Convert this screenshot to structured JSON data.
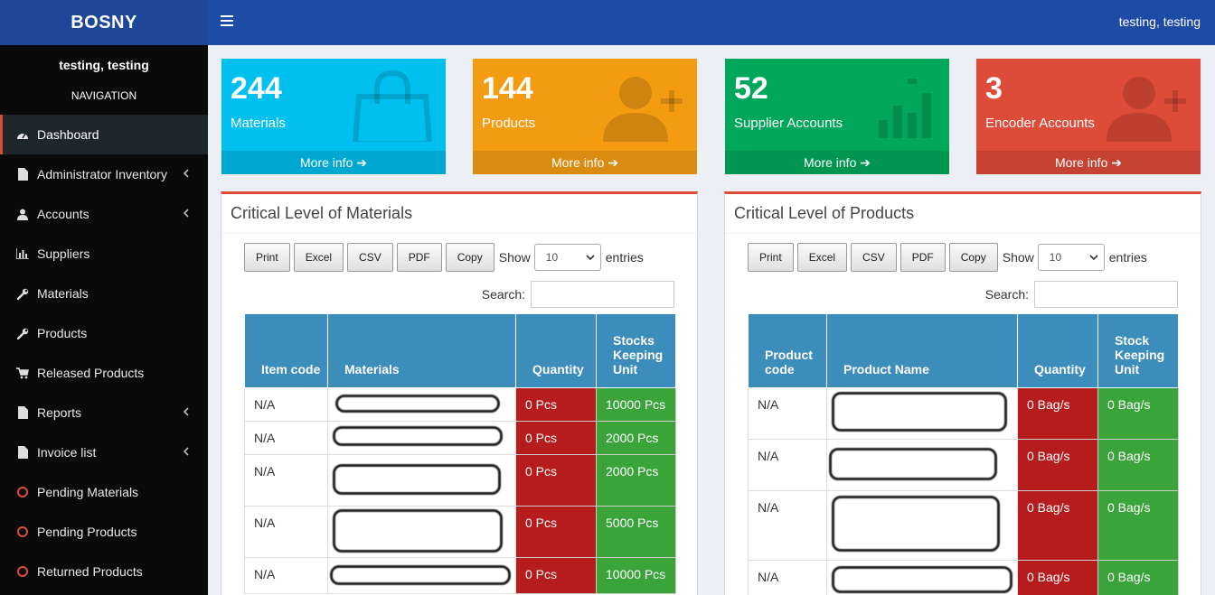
{
  "brand": "BOSNY",
  "header": {
    "user": "testing, testing"
  },
  "sidebar": {
    "user": "testing, testing",
    "nav_header": "NAVIGATION",
    "items": [
      {
        "label": "Dashboard",
        "icon": "dashboard-icon"
      },
      {
        "label": "Administrator Inventory",
        "icon": "file-icon"
      },
      {
        "label": "Accounts",
        "icon": "user-icon"
      },
      {
        "label": "Suppliers",
        "icon": "bar-chart-icon"
      },
      {
        "label": "Materials",
        "icon": "wrench-icon"
      },
      {
        "label": "Products",
        "icon": "wrench-icon"
      },
      {
        "label": "Released Products",
        "icon": "cart-icon"
      },
      {
        "label": "Reports",
        "icon": "file-icon"
      },
      {
        "label": "Invoice list",
        "icon": "file-icon"
      },
      {
        "label": "Pending Materials",
        "icon": "circle-icon"
      },
      {
        "label": "Pending Products",
        "icon": "circle-icon"
      },
      {
        "label": "Returned Products",
        "icon": "circle-icon"
      }
    ]
  },
  "boxes": [
    {
      "value": "244",
      "label": "Materials",
      "more": "More info"
    },
    {
      "value": "144",
      "label": "Products",
      "more": "More info"
    },
    {
      "value": "52",
      "label": "Supplier Accounts",
      "more": "More info"
    },
    {
      "value": "3",
      "label": "Encoder Accounts",
      "more": "More info"
    }
  ],
  "colors": {
    "aqua": "#00c0ef",
    "yellow": "#f39c12",
    "green": "#00a65a",
    "red": "#dd4b39",
    "table_head": "#3c8dbc"
  },
  "table_controls": {
    "buttons": [
      "Print",
      "Excel",
      "CSV",
      "PDF",
      "Copy"
    ],
    "show": "Show",
    "page_size": "10",
    "entries": "entries",
    "search": "Search:"
  },
  "materials_panel": {
    "title": "Critical Level of Materials",
    "headers": [
      "Item code",
      "Materials",
      "Quantity",
      "Stocks Keeping Unit"
    ],
    "rows": [
      {
        "code": "N/A",
        "qty": "0 Pcs",
        "sku": "10000 Pcs"
      },
      {
        "code": "N/A",
        "qty": "0 Pcs",
        "sku": "2000 Pcs"
      },
      {
        "code": "N/A",
        "qty": "0 Pcs",
        "sku": "2000 Pcs"
      },
      {
        "code": "N/A",
        "qty": "0 Pcs",
        "sku": "5000 Pcs"
      },
      {
        "code": "N/A",
        "qty": "0 Pcs",
        "sku": "10000 Pcs"
      }
    ]
  },
  "products_panel": {
    "title": "Critical Level of Products",
    "headers": [
      "Product code",
      "Product Name",
      "Quantity",
      "Stock Keeping Unit"
    ],
    "rows": [
      {
        "code": "N/A",
        "qty": "0 Bag/s",
        "sku": "0 Bag/s"
      },
      {
        "code": "N/A",
        "qty": "0 Bag/s",
        "sku": "0 Bag/s"
      },
      {
        "code": "N/A",
        "qty": "0 Bag/s",
        "sku": "0 Bag/s"
      },
      {
        "code": "N/A",
        "qty": "0 Bag/s",
        "sku": "0 Bag/s"
      }
    ]
  }
}
